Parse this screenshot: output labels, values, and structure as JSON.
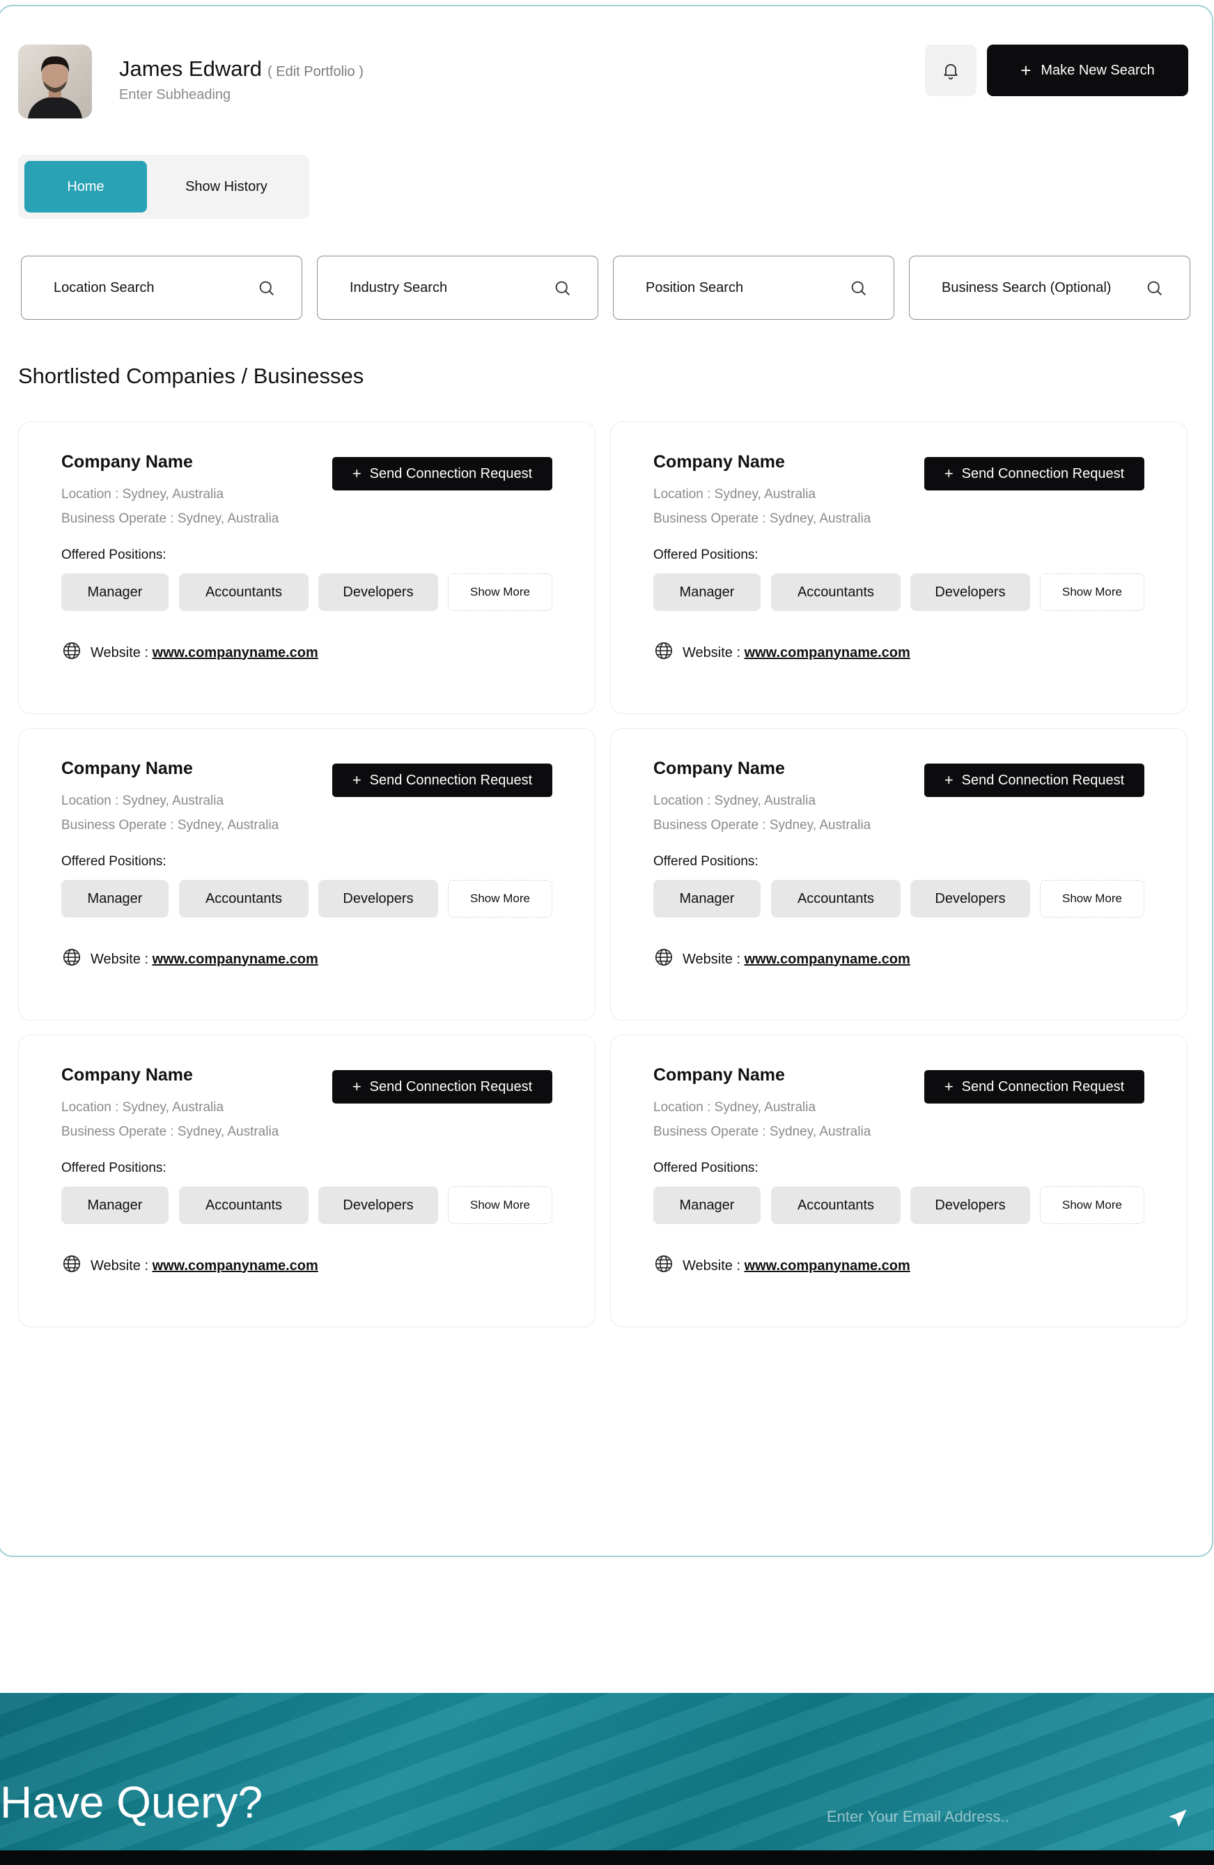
{
  "header": {
    "user_name": "James Edward",
    "edit_label": "( Edit Portfolio )",
    "subheading": "Enter Subheading",
    "new_search_label": "Make New Search"
  },
  "tabs": [
    {
      "label": "Home",
      "active": true
    },
    {
      "label": "Show History",
      "active": false
    }
  ],
  "search_fields": [
    {
      "label": "Location Search"
    },
    {
      "label": "Industry Search"
    },
    {
      "label": "Position Search"
    },
    {
      "label": "Business Search (Optional)"
    }
  ],
  "section_title": "Shortlisted Companies / Businesses",
  "cards": [
    {
      "name": "Company Name",
      "connect_label": "Send Connection Request",
      "location": "Location : Sydney, Australia",
      "business_operate": "Business Operate : Sydney, Australia",
      "offered_label": "Offered Positions:",
      "positions": [
        "Manager",
        "Accountants",
        "Developers"
      ],
      "show_more": "Show More",
      "website_label": "Website :",
      "website_url": "www.companyname.com"
    },
    {
      "name": "Company Name",
      "connect_label": "Send Connection Request",
      "location": "Location : Sydney, Australia",
      "business_operate": "Business Operate : Sydney, Australia",
      "offered_label": "Offered Positions:",
      "positions": [
        "Manager",
        "Accountants",
        "Developers"
      ],
      "show_more": "Show More",
      "website_label": "Website :",
      "website_url": "www.companyname.com"
    },
    {
      "name": "Company Name",
      "connect_label": "Send Connection Request",
      "location": "Location : Sydney, Australia",
      "business_operate": "Business Operate : Sydney, Australia",
      "offered_label": "Offered Positions:",
      "positions": [
        "Manager",
        "Accountants",
        "Developers"
      ],
      "show_more": "Show More",
      "website_label": "Website :",
      "website_url": "www.companyname.com"
    },
    {
      "name": "Company Name",
      "connect_label": "Send Connection Request",
      "location": "Location : Sydney, Australia",
      "business_operate": "Business Operate : Sydney, Australia",
      "offered_label": "Offered Positions:",
      "positions": [
        "Manager",
        "Accountants",
        "Developers"
      ],
      "show_more": "Show More",
      "website_label": "Website :",
      "website_url": "www.companyname.com"
    },
    {
      "name": "Company Name",
      "connect_label": "Send Connection Request",
      "location": "Location : Sydney, Australia",
      "business_operate": "Business Operate : Sydney, Australia",
      "offered_label": "Offered Positions:",
      "positions": [
        "Manager",
        "Accountants",
        "Developers"
      ],
      "show_more": "Show More",
      "website_label": "Website :",
      "website_url": "www.companyname.com"
    },
    {
      "name": "Company Name",
      "connect_label": "Send Connection Request",
      "location": "Location : Sydney, Australia",
      "business_operate": "Business Operate : Sydney, Australia",
      "offered_label": "Offered Positions:",
      "positions": [
        "Manager",
        "Accountants",
        "Developers"
      ],
      "show_more": "Show More",
      "website_label": "Website :",
      "website_url": "www.companyname.com"
    }
  ],
  "footer": {
    "title": "Have Query?",
    "email_placeholder": "Enter Your Email Address.."
  },
  "colors": {
    "accent": "#2aa2b5",
    "primary_button": "#0c0c0e",
    "pill_bg": "#e7e7e7",
    "footer_teal": "#1a8c9b"
  },
  "icons": [
    "bell-icon",
    "plus-icon",
    "search-icon",
    "globe-icon",
    "send-icon"
  ]
}
